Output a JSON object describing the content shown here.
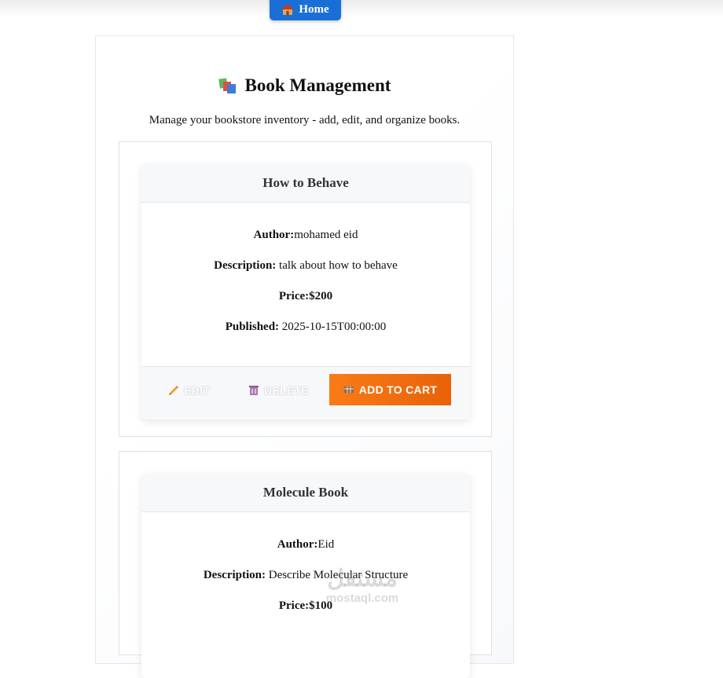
{
  "nav": {
    "home_label": "Home"
  },
  "header": {
    "title": "Book Management",
    "subtitle": "Manage your bookstore inventory - add, edit, and organize books."
  },
  "labels": {
    "author": "Author:",
    "description": "Description:",
    "price": "Price:",
    "published": "Published:"
  },
  "actions": {
    "edit_label": "EDIT",
    "delete_label": "DELETE",
    "add_to_cart_label": "ADD TO CART"
  },
  "books": [
    {
      "title": "How to Behave",
      "author": "mohamed eid",
      "description": "talk about how to behave",
      "price": "$200",
      "published": "2025-10-15T00:00:00"
    },
    {
      "title": "Molecule Book",
      "author": "Eid",
      "description": "Describe Molecular Structure",
      "price": "$100"
    }
  ],
  "watermark": {
    "main": "مستقل",
    "sub": "mostaql.com"
  },
  "colors": {
    "home_button": "#1a6fd6",
    "cart_button": "#f97b16",
    "header_bg": "#f7f8fa"
  }
}
